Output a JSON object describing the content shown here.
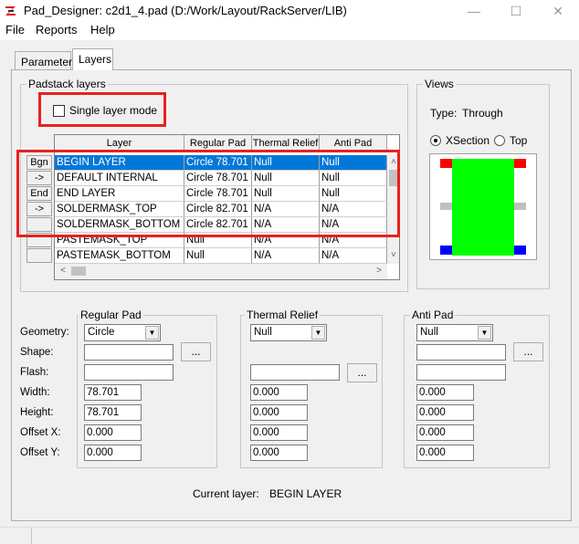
{
  "window": {
    "title": "Pad_Designer: c2d1_4.pad (D:/Work/Layout/RackServer/LIB)",
    "minimize": "—",
    "maximize": "☐",
    "close": "✕"
  },
  "menu": [
    "File",
    "Reports",
    "Help"
  ],
  "tabs": [
    "Parameters",
    "Layers"
  ],
  "padstack_layers": {
    "group_label": "Padstack layers",
    "single_layer_mode_label": "Single layer mode",
    "single_layer_mode_checked": false,
    "columns": [
      "Layer",
      "Regular Pad",
      "Thermal Relief",
      "Anti Pad"
    ],
    "rows": [
      {
        "button": "Bgn",
        "layer": "BEGIN LAYER",
        "regular": "Circle 78.701",
        "thermal": "Null",
        "anti": "Null",
        "selected": true
      },
      {
        "button": "->",
        "layer": "DEFAULT INTERNAL",
        "regular": "Circle 78.701",
        "thermal": "Null",
        "anti": "Null"
      },
      {
        "button": "End",
        "layer": "END LAYER",
        "regular": "Circle 78.701",
        "thermal": "Null",
        "anti": "Null"
      },
      {
        "button": "->",
        "layer": "SOLDERMASK_TOP",
        "regular": "Circle 82.701",
        "thermal": "N/A",
        "anti": "N/A"
      },
      {
        "button": "",
        "layer": "SOLDERMASK_BOTTOM",
        "regular": "Circle 82.701",
        "thermal": "N/A",
        "anti": "N/A"
      },
      {
        "button": "",
        "layer": "PASTEMASK_TOP",
        "regular": "Null",
        "thermal": "N/A",
        "anti": "N/A"
      },
      {
        "button": "",
        "layer": "PASTEMASK_BOTTOM",
        "regular": "Null",
        "thermal": "N/A",
        "anti": "N/A"
      }
    ]
  },
  "views": {
    "group_label": "Views",
    "type_label": "Type:",
    "type_value": "Through",
    "xsection_label": "XSection",
    "top_label": "Top",
    "selected": "XSection",
    "colors": {
      "pad": "#00ff00",
      "soldermask": "#ff0000",
      "pastemask": "#0000ff",
      "internal": "#c0c0c0"
    }
  },
  "field_labels": [
    "Geometry:",
    "Shape:",
    "Flash:",
    "Width:",
    "Height:",
    "Offset X:",
    "Offset Y:"
  ],
  "regular_pad": {
    "label": "Regular Pad",
    "geometry": "Circle",
    "shape": "",
    "flash": "",
    "width": "78.701",
    "height": "78.701",
    "offset_x": "0.000",
    "offset_y": "0.000"
  },
  "thermal_relief": {
    "label": "Thermal Relief",
    "geometry": "Null",
    "flash": "",
    "width": "0.000",
    "height": "0.000",
    "offset_x": "0.000",
    "offset_y": "0.000"
  },
  "anti_pad": {
    "label": "Anti Pad",
    "geometry": "Null",
    "shape": "",
    "flash": "",
    "width": "0.000",
    "height": "0.000",
    "offset_x": "0.000",
    "offset_y": "0.000"
  },
  "current_layer_label": "Current layer:",
  "current_layer_value": "BEGIN LAYER",
  "dots_label": "...",
  "icons": {
    "dropdown": "▼",
    "scroll_up": "˄",
    "scroll_down": "˅",
    "scroll_left": "<",
    "scroll_right": ">"
  }
}
